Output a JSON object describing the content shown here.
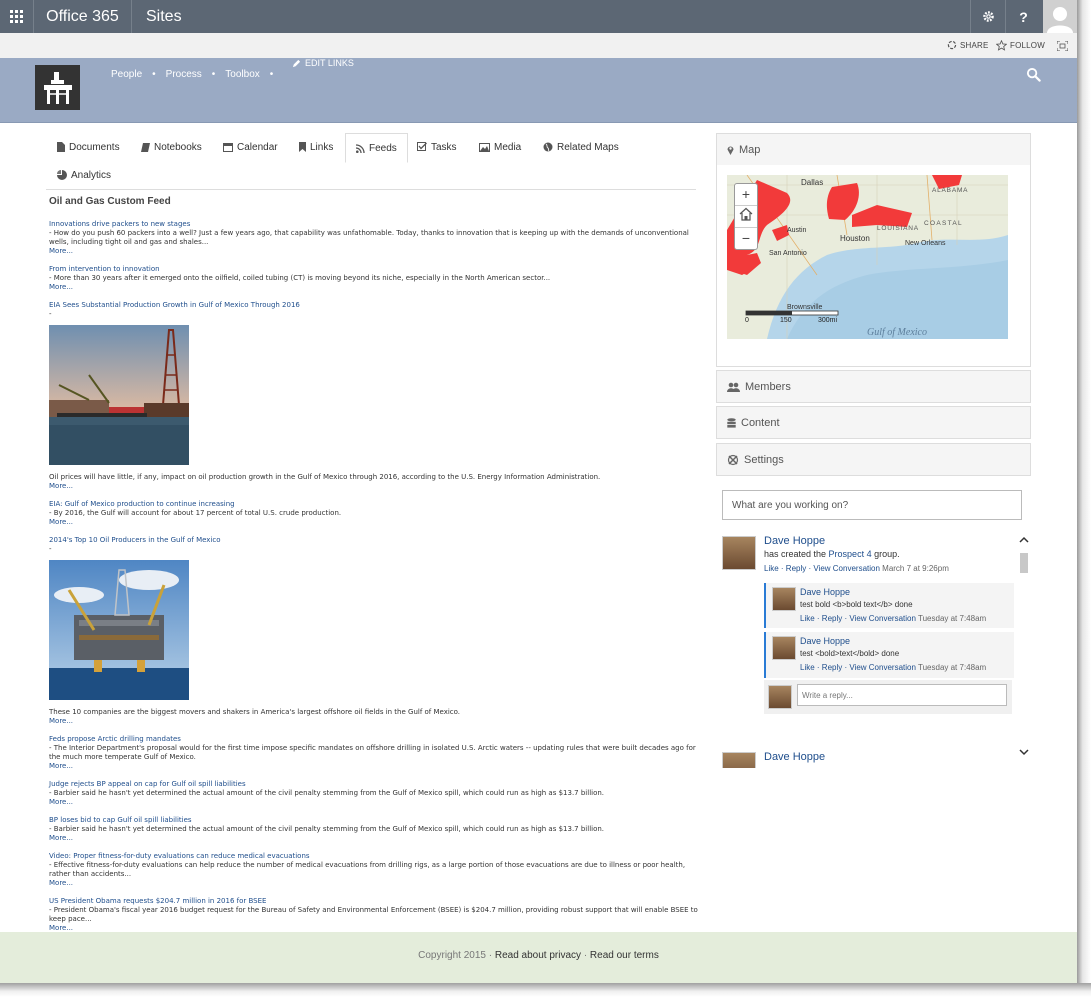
{
  "suite": {
    "brand": "Office 365",
    "app": "Sites",
    "settings_icon": "gear-icon",
    "help_label": "?"
  },
  "ribbon": {
    "share": "SHARE",
    "follow": "FOLLOW"
  },
  "site": {
    "nav": [
      "People",
      "Process",
      "Toolbox"
    ],
    "edit_links": "EDIT LINKS"
  },
  "tabs": [
    {
      "label": "Documents",
      "icon": "document-icon"
    },
    {
      "label": "Notebooks",
      "icon": "book-icon"
    },
    {
      "label": "Calendar",
      "icon": "calendar-icon"
    },
    {
      "label": "Links",
      "icon": "bookmark-icon"
    },
    {
      "label": "Feeds",
      "icon": "rss-icon",
      "active": true
    },
    {
      "label": "Tasks",
      "icon": "checkbox-icon"
    },
    {
      "label": "Media",
      "icon": "image-icon"
    },
    {
      "label": "Related Maps",
      "icon": "globe-icon"
    },
    {
      "label": "Analytics",
      "icon": "pie-chart-icon"
    }
  ],
  "feed": {
    "title": "Oil and Gas Custom Feed",
    "more": "More...",
    "items": [
      {
        "title": "Innovations drive packers to new stages",
        "text": "- How do you push 60 packers into a well? Just a few years ago, that capability was unfathomable. Today, thanks to innovation that is keeping up with the demands of unconventional wells, including tight oil and gas and shales..."
      },
      {
        "title": "From intervention to innovation",
        "text": "- More than 30 years after it emerged onto the oilfield, coiled tubing (CT) is moving beyond its niche, especially in the North American sector..."
      },
      {
        "title": "EIA Sees Substantial Production Growth in Gulf of Mexico Through 2016",
        "text": "-",
        "image": "oil-rig-harbor",
        "after": "Oil prices will have little, if any, impact on oil production growth in the Gulf of Mexico through 2016, according to the U.S. Energy Information Administration."
      },
      {
        "title": "EIA: Gulf of Mexico production to continue increasing",
        "text": "- By 2016, the Gulf will account for about 17 percent of total U.S. crude production."
      },
      {
        "title": "2014's Top 10 Oil Producers in the Gulf of Mexico",
        "text": "-",
        "image": "offshore-platform",
        "after": "These 10 companies are the biggest movers and shakers in America's largest offshore oil fields in the Gulf of Mexico."
      },
      {
        "title": "Feds propose Arctic drilling mandates",
        "text": "- The Interior Department's proposal would for the first time impose specific mandates on offshore drilling in isolated U.S. Arctic waters -- updating rules that were built decades ago for the much more temperate Gulf of Mexico."
      },
      {
        "title": "Judge rejects BP appeal on cap for Gulf oil spill liabilities",
        "text": "- Barbier said he hasn't yet determined the actual amount of the civil penalty stemming from the Gulf of Mexico spill, which could run as high as $13.7 billion."
      },
      {
        "title": "BP loses bid to cap Gulf oil spill liabilities",
        "text": "- Barbier said he hasn't yet determined the actual amount of the civil penalty stemming from the Gulf of Mexico spill, which could run as high as $13.7 billion."
      },
      {
        "title": "Video: Proper fitness-for-duty evaluations can reduce medical evacuations",
        "text": "- Effective fitness-for-duty evaluations can help reduce the number of medical evacuations from drilling rigs, as a large portion of those evacuations are due to illness or poor health, rather than accidents..."
      },
      {
        "title": "US President Obama requests $204.7 million in 2016 for BSEE",
        "text": "- President Obama's fiscal year 2016 budget request for the Bureau of Safety and Environmental Enforcement (BSEE) is $204.7 million, providing robust support that will enable BSEE to keep pace..."
      }
    ]
  },
  "map": {
    "title": "Map",
    "zoom_in": "+",
    "zoom_out": "−",
    "labels": {
      "dallas": "Dallas",
      "alabama": "ALABAMA",
      "louisiana": "LOUISIANA",
      "coastal": "COASTAL",
      "houston": "Houston",
      "new_orleans": "New Orleans",
      "austin": "Austin",
      "san_antonio": "San Antonio",
      "brownsville": "Brownsville",
      "gulf": "Gulf of Mexico",
      "scale_0": "0",
      "scale_150": "150",
      "scale_300": "300mi"
    }
  },
  "panels": {
    "members": "Members",
    "content": "Content",
    "settings": "Settings"
  },
  "newsfeed": {
    "placeholder": "What are you working on?",
    "post": {
      "author": "Dave Hoppe",
      "text_before": "has created the ",
      "link": "Prospect 4",
      "text_after": " group.",
      "actions": [
        "Like",
        "Reply",
        "View Conversation"
      ],
      "time": "March 7 at 9:26pm"
    },
    "replies": [
      {
        "author": "Dave Hoppe",
        "text": "test bold <b>bold text</b> done",
        "time": "Tuesday at 7:48am"
      },
      {
        "author": "Dave Hoppe",
        "text": "test <bold>text</bold> done",
        "time": "Tuesday at 7:48am"
      }
    ],
    "reply_placeholder": "Write a reply...",
    "next_author": "Dave Hoppe"
  },
  "footer": {
    "copyright": "Copyright 2015",
    "privacy": "Read about privacy",
    "terms": "Read our terms"
  }
}
